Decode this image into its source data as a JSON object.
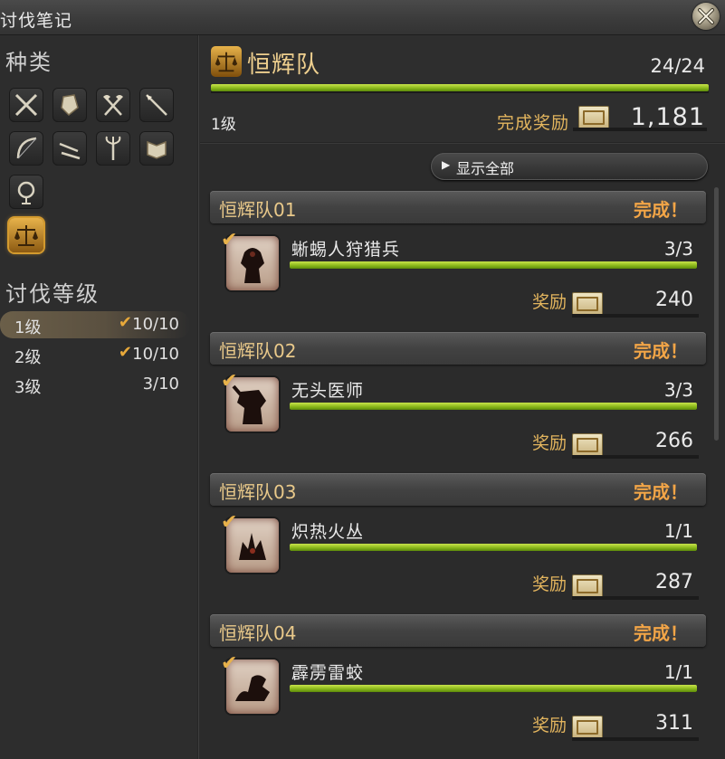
{
  "window": {
    "title": "讨伐笔记"
  },
  "left": {
    "category_title": "种类",
    "categories": [
      {
        "icon": "crossed-swords-icon"
      },
      {
        "icon": "gauntlet-icon"
      },
      {
        "icon": "crossed-axes-icon"
      },
      {
        "icon": "lance-icon"
      },
      {
        "icon": "bow-icon"
      },
      {
        "icon": "daggers-icon"
      },
      {
        "icon": "staff-icon"
      },
      {
        "icon": "book-icon"
      },
      {
        "icon": "globe-icon"
      },
      {
        "icon": "scales-icon",
        "selected": true
      }
    ],
    "level_title": "讨伐等级",
    "levels": [
      {
        "label": "1级",
        "progress": "10/10",
        "complete": true,
        "selected": true
      },
      {
        "label": "2级",
        "progress": "10/10",
        "complete": true
      },
      {
        "label": "3级",
        "progress": "3/10",
        "complete": false
      }
    ],
    "check_mark": "✔"
  },
  "header": {
    "icon": "scales-icon",
    "title": "恒辉队",
    "progress": "24/24",
    "progress_fraction": 1.0,
    "level": "1级",
    "reward_label": "完成奖励",
    "reward_icon": "seal-icon",
    "reward_value": "1,181"
  },
  "show_all": {
    "label": "显示全部",
    "icon": "play-triangle-icon"
  },
  "groups": [
    {
      "name": "恒辉队01",
      "status": "完成！",
      "mob": "蜥蜴人狩猎兵",
      "count": "3/3",
      "fraction": 1.0,
      "reward_label": "奖励",
      "reward": "240"
    },
    {
      "name": "恒辉队02",
      "status": "完成！",
      "mob": "无头医师",
      "count": "3/3",
      "fraction": 1.0,
      "reward_label": "奖励",
      "reward": "266"
    },
    {
      "name": "恒辉队03",
      "status": "完成！",
      "mob": "炽热火丛",
      "count": "1/1",
      "fraction": 1.0,
      "reward_label": "奖励",
      "reward": "287"
    },
    {
      "name": "恒辉队04",
      "status": "完成！",
      "mob": "霹雳雷蛟",
      "count": "1/1",
      "fraction": 1.0,
      "reward_label": "奖励",
      "reward": "311"
    }
  ],
  "colors": {
    "accent_gold": "#e3b55e",
    "complete_orange": "#f2a547",
    "bar_green": "#a6d02c"
  }
}
